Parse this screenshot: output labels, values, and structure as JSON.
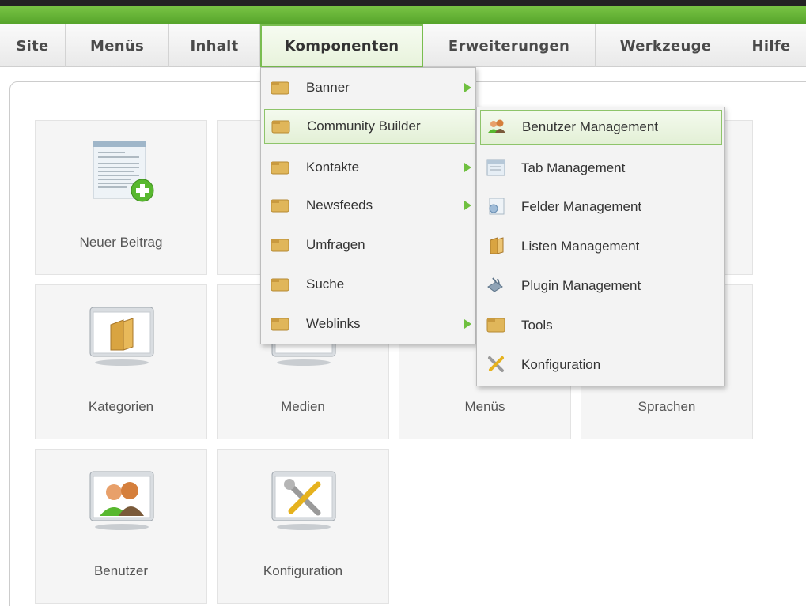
{
  "menubar": {
    "items": [
      {
        "label": "Site"
      },
      {
        "label": "Menüs"
      },
      {
        "label": "Inhalt"
      },
      {
        "label": "Komponenten"
      },
      {
        "label": "Erweiterungen"
      },
      {
        "label": "Werkzeuge"
      },
      {
        "label": "Hilfe"
      }
    ],
    "active_index": 3
  },
  "tiles": [
    {
      "label": "Neuer Beitrag",
      "icon": "new-article-icon"
    },
    {
      "label": "Kategorien",
      "icon": "categories-icon"
    },
    {
      "label": "Medien",
      "icon": "media-icon"
    },
    {
      "label": "Menüs",
      "icon": "menus-icon"
    },
    {
      "label": "Sprachen",
      "icon": "languages-icon"
    },
    {
      "label": "Benutzer",
      "icon": "users-icon"
    },
    {
      "label": "Konfiguration",
      "icon": "configuration-icon"
    }
  ],
  "komponenten_menu": {
    "items": [
      {
        "label": "Banner",
        "has_submenu": true
      },
      {
        "label": "Community Builder",
        "has_submenu": true,
        "highlighted": true
      },
      {
        "label": "Kontakte",
        "has_submenu": true
      },
      {
        "label": "Newsfeeds",
        "has_submenu": true
      },
      {
        "label": "Umfragen",
        "has_submenu": false
      },
      {
        "label": "Suche",
        "has_submenu": false
      },
      {
        "label": "Weblinks",
        "has_submenu": true
      }
    ]
  },
  "community_builder_menu": {
    "items": [
      {
        "label": "Benutzer Management",
        "icon": "user-management-icon",
        "highlighted": true
      },
      {
        "label": "Tab Management",
        "icon": "tab-management-icon"
      },
      {
        "label": "Felder Management",
        "icon": "field-management-icon"
      },
      {
        "label": "Listen Management",
        "icon": "list-management-icon"
      },
      {
        "label": "Plugin Management",
        "icon": "plugin-management-icon"
      },
      {
        "label": "Tools",
        "icon": "folder-icon"
      },
      {
        "label": "Konfiguration",
        "icon": "configuration-tools-icon"
      }
    ]
  },
  "colors": {
    "accent_green": "#6fc03f",
    "menubar_active_border": "#79bd4f",
    "text": "#4a4a4a"
  }
}
